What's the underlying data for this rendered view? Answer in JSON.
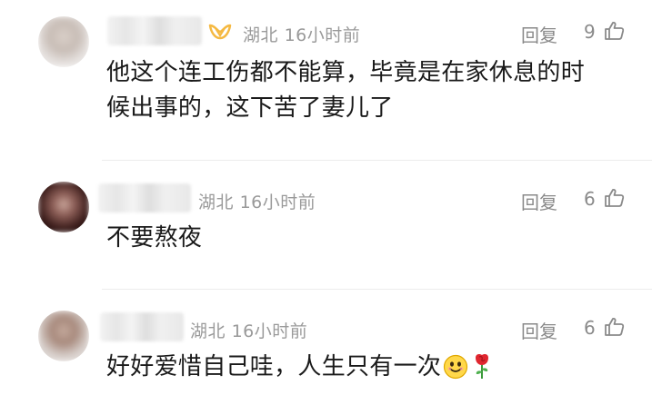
{
  "comments": [
    {
      "location": "湖北",
      "time": "16小时前",
      "reply_label": "回复",
      "likes": "9",
      "text_lines": [
        "他这个连工伤都不能算，毕竟是在家休息的时",
        "候出事的，这下苦了妻儿了"
      ],
      "badge": "vip-badge-icon"
    },
    {
      "location": "湖北",
      "time": "16小时前",
      "reply_label": "回复",
      "likes": "6",
      "text_lines": [
        "不要熬夜"
      ]
    },
    {
      "location": "湖北",
      "time": "16小时前",
      "reply_label": "回复",
      "likes": "6",
      "text_lines": [
        "好好爱惜自己哇，人生只有一次"
      ],
      "emojis": [
        "smiley-emoji",
        "rose-emoji"
      ]
    }
  ],
  "colors": {
    "meta_text": "#9a9a9a",
    "body_text": "#1a1a1a",
    "badge": "#f5b942"
  }
}
